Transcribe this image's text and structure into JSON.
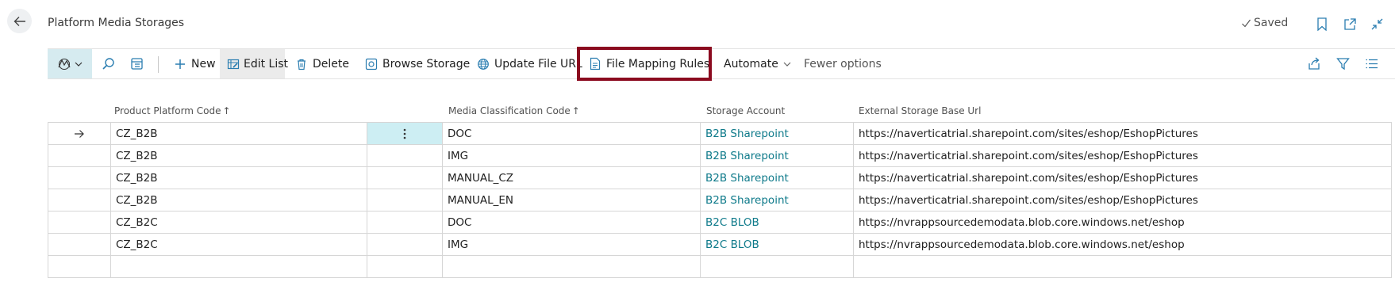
{
  "header": {
    "title": "Platform Media Storages",
    "saved_label": "Saved",
    "icons": [
      "back-arrow-icon",
      "bookmark-icon",
      "open-new-window-icon",
      "collapse-icon"
    ]
  },
  "actionbar": {
    "items": [
      {
        "name": "New",
        "icon": "plus-icon"
      },
      {
        "name": "Edit List",
        "icon": "edit-list-icon"
      },
      {
        "name": "Delete",
        "icon": "trash-icon"
      },
      {
        "name": "Browse Storage",
        "icon": "browse-icon"
      },
      {
        "name": "Update File URL",
        "icon": "globe-icon"
      },
      {
        "name": "File Mapping Rules",
        "icon": "document-icon"
      },
      {
        "name": "Automate",
        "icon": "chevron-down-icon"
      },
      {
        "name": "Fewer options"
      }
    ],
    "highlight_color": "#8b0a1f"
  },
  "columns": {
    "product_platform_code": "Product Platform Code",
    "media_classification_code": "Media Classification Code",
    "storage_account": "Storage Account",
    "external_storage_base_url": "External Storage Base Url",
    "sort_indicator": "↑"
  },
  "rows": [
    {
      "platform": "CZ_B2B",
      "media": "DOC",
      "account": "B2B Sharepoint",
      "url": "https://naverticatrial.sharepoint.com/sites/eshop/EshopPictures",
      "current": true
    },
    {
      "platform": "CZ_B2B",
      "media": "IMG",
      "account": "B2B Sharepoint",
      "url": "https://naverticatrial.sharepoint.com/sites/eshop/EshopPictures"
    },
    {
      "platform": "CZ_B2B",
      "media": "MANUAL_CZ",
      "account": "B2B Sharepoint",
      "url": "https://naverticatrial.sharepoint.com/sites/eshop/EshopPictures"
    },
    {
      "platform": "CZ_B2B",
      "media": "MANUAL_EN",
      "account": "B2B Sharepoint",
      "url": "https://naverticatrial.sharepoint.com/sites/eshop/EshopPictures"
    },
    {
      "platform": "CZ_B2C",
      "media": "DOC",
      "account": "B2C BLOB",
      "url": "https://nvrappsourcedemodata.blob.core.windows.net/eshop"
    },
    {
      "platform": "CZ_B2C",
      "media": "IMG",
      "account": "B2C BLOB",
      "url": "https://nvrappsourcedemodata.blob.core.windows.net/eshop"
    }
  ],
  "colors": {
    "link": "#0e7a8a",
    "active_row_menu": "#cdeef3",
    "accent": "#0e7a8a"
  }
}
